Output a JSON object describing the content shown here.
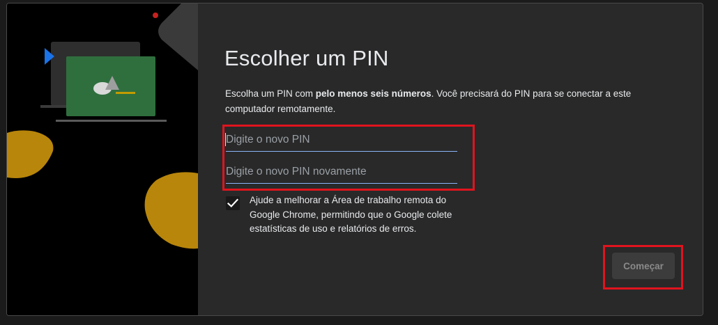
{
  "dialog": {
    "title": "Escolher um PIN",
    "description": {
      "part1": "Escolha um PIN com ",
      "bold": "pelo menos seis números",
      "part2": ". Você precisará do PIN para se conectar a este computador remotamente."
    },
    "pin_field": {
      "placeholder": "Digite o novo PIN",
      "value": ""
    },
    "pin_confirm_field": {
      "placeholder": "Digite o novo PIN novamente",
      "value": ""
    },
    "consent": {
      "checked": true,
      "label": "Ajude a melhorar a Área de trabalho remota do Google Chrome, permitindo que o Google colete estatísticas de uso e relatórios de erros."
    },
    "start_button": {
      "label": "Começar",
      "enabled": false
    }
  },
  "colors": {
    "background": "#292929",
    "illustration_background": "#000000",
    "text": "#e8eaed",
    "placeholder": "#9aa0a6",
    "focus_underline": "#8ab4f8",
    "highlight_border": "#e0141e",
    "button_background": "#3c3c3c",
    "button_text_disabled": "#8a8a8a",
    "green_card": "#2f6f3e",
    "yellow_blob": "#b8860b"
  },
  "icons": {
    "checkbox_mark": "check-icon",
    "illustration_play": "play-triangle-icon",
    "illustration_shapes": "shapes-icon"
  }
}
